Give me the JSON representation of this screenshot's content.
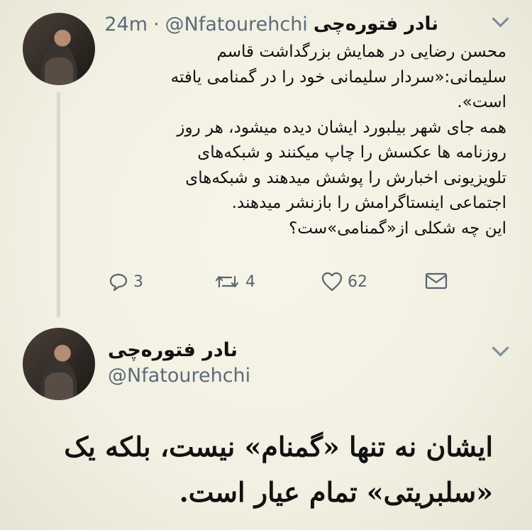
{
  "tweet": {
    "author_name": "نادر فتوره‌چی",
    "handle": "@Nfatourehchi",
    "separator": "·",
    "time": "24m",
    "lines": [
      "محسن رضایی در همایش بزرگداشت قاسم",
      "سلیمانی:«سردار سلیمانی خود را در گمنامی یافته",
      "است».",
      "همه جای شهر بیلبورد ایشان دیده میشود، هر روز",
      "روزنامه ها عکسش را چاپ میکنند و شبکه‌های",
      "تلویزیونی اخبارش را پوشش میدهند و شبکه‌های",
      "اجتماعی اینستاگرامش را بازنشر میدهند.",
      "این چه  شکلی از«گمنامی»ست؟"
    ],
    "actions": {
      "reply_count": "3",
      "retweet_count": "4",
      "like_count": "62"
    },
    "icons": [
      "reply-icon",
      "retweet-icon",
      "like-icon",
      "direct-message-icon",
      "chevron-down-icon"
    ]
  },
  "reply": {
    "author_name": "نادر فتوره‌چی",
    "handle": "@Nfatourehchi",
    "lines": [
      "ایشان نه تنها «گمنام» نیست، بلکه یک",
      "«سلبریتی» تمام عیار است."
    ]
  },
  "colors": {
    "background": "#f2f0e2",
    "secondary_text": "#5b6b79",
    "thread_line": "#d8d8cf"
  }
}
